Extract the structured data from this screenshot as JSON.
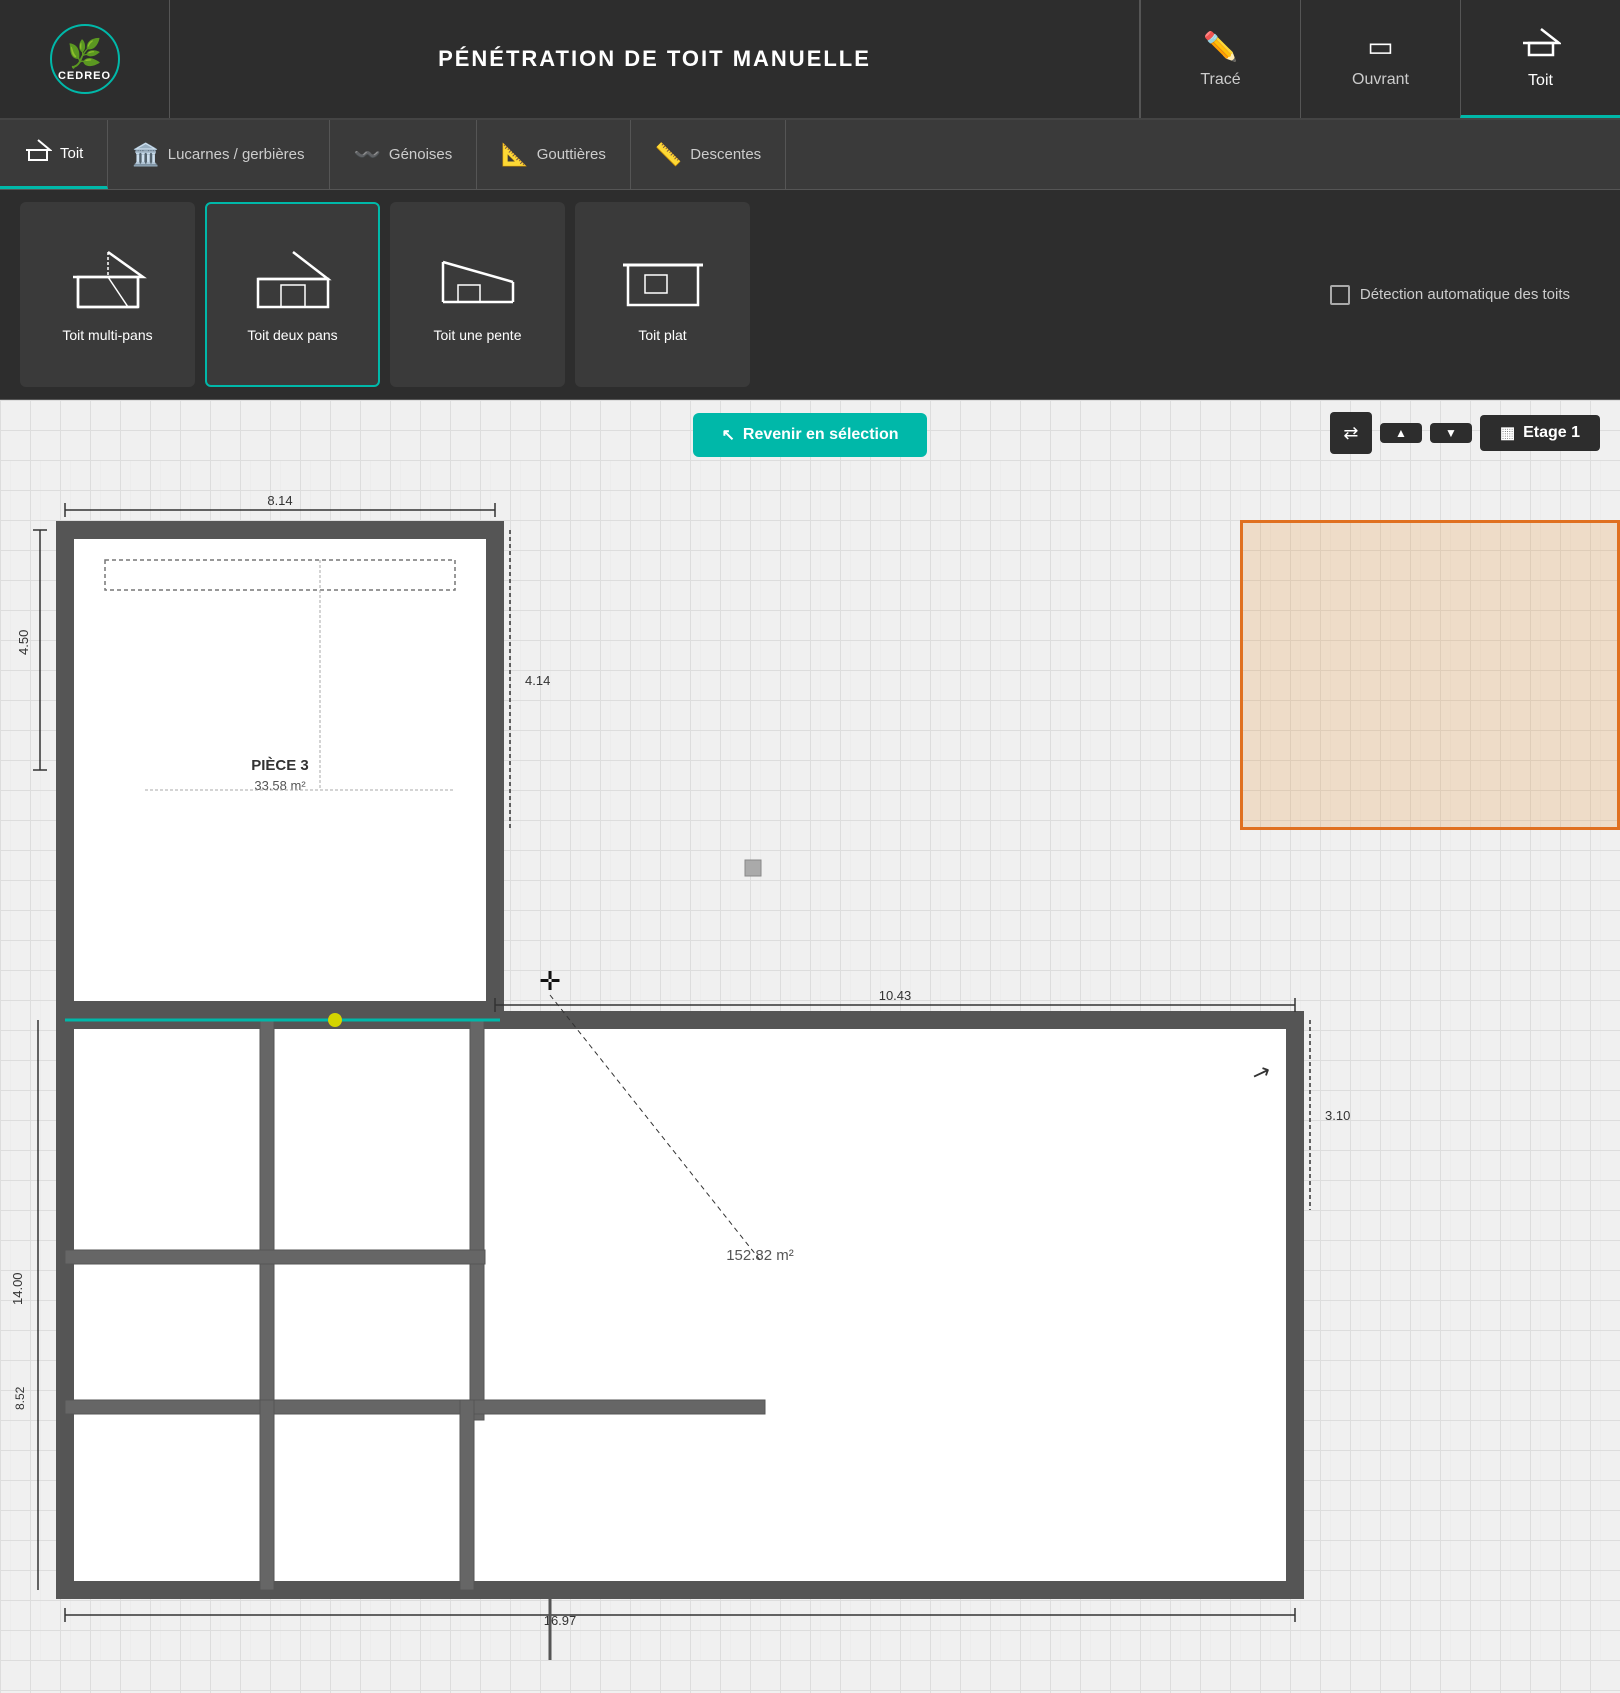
{
  "logo": {
    "text": "CEDREO",
    "icon": "🌿"
  },
  "app_title": "PÉNÉTRATION DE TOIT MANUELLE",
  "top_tools": [
    {
      "id": "trace",
      "label": "Tracé",
      "icon": "✏️",
      "active": false
    },
    {
      "id": "ouvrant",
      "label": "Ouvrant",
      "icon": "🪟",
      "active": false
    },
    {
      "id": "toit",
      "label": "Toit",
      "icon": "🏠",
      "active": true
    }
  ],
  "nav_tabs": [
    {
      "id": "toit",
      "label": "Toit",
      "icon": "🏠",
      "active": true
    },
    {
      "id": "lucarnes",
      "label": "Lucarnes / gerbières",
      "icon": "🏛️",
      "active": false
    },
    {
      "id": "genoises",
      "label": "Génoises",
      "icon": "〰️",
      "active": false
    },
    {
      "id": "gouttieres",
      "label": "Gouttières",
      "icon": "📐",
      "active": false
    },
    {
      "id": "descentes",
      "label": "Descentes",
      "icon": "📏",
      "active": false
    }
  ],
  "roof_types": [
    {
      "id": "multi-pans",
      "label": "Toit multi-pans",
      "active": false
    },
    {
      "id": "deux-pans",
      "label": "Toit deux pans",
      "active": true
    },
    {
      "id": "une-pente",
      "label": "Toit une pente",
      "active": false
    },
    {
      "id": "plat",
      "label": "Toit plat",
      "active": false
    }
  ],
  "auto_detect": "Détection automatique des toits",
  "canvas": {
    "return_button": "Revenir en sélection",
    "floor_label": "Etage 1",
    "dimensions": {
      "top": "8.14",
      "right_top": "4.14",
      "right_big": "10.43",
      "left_vertical": "4.50",
      "left_big": "14.00",
      "right_side": "3.10",
      "bottom_left": "8.52",
      "bottom_measure": "16.97"
    },
    "rooms": [
      {
        "name": "PIÈCE 3",
        "area": "33.58 m²"
      }
    ],
    "area_label": "152.82 m²"
  }
}
